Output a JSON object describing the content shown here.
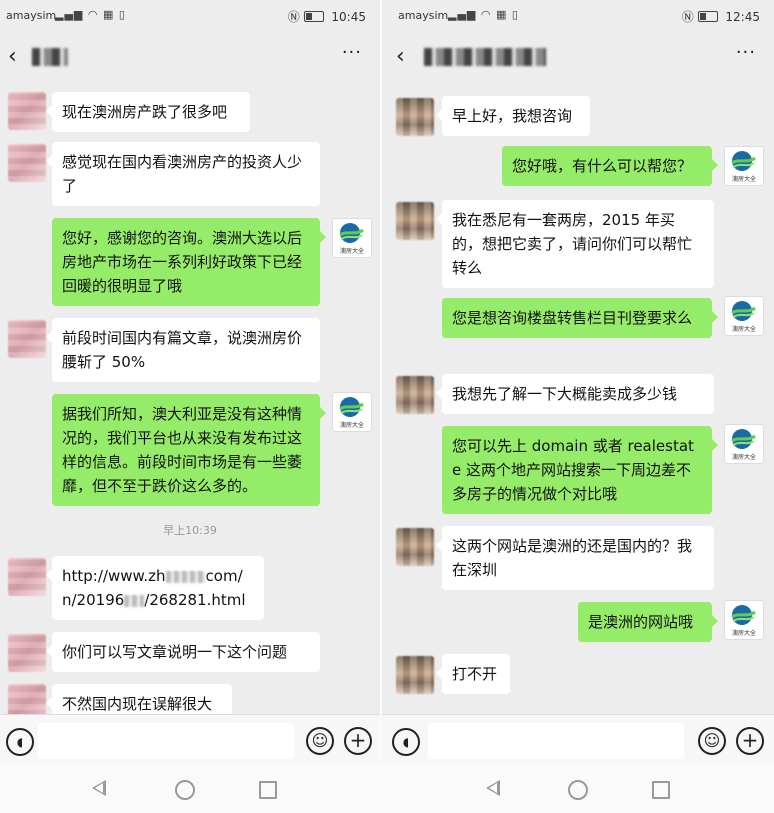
{
  "left": {
    "status": {
      "carrier": "amaysim",
      "time": "10:45"
    },
    "more_label": "···",
    "messages": [
      {
        "text": "现在澳洲房产跌了很多吧"
      },
      {
        "text": "感觉现在国内看澳洲房产的投资人少了"
      },
      {
        "text": "您好，感谢您的咨询。澳洲大选以后房地产市场在一系列利好政策下已经回暖的很明显了哦"
      },
      {
        "text": "前段时间国内有篇文章，说澳洲房价腰斩了 50%"
      },
      {
        "text": "据我们所知，澳大利亚是没有这种情况的，我们平台也从来没有发布过这样的信息。前段时间市场是有一些萎靡，但不至于跌价这么多的。"
      },
      {
        "text": "你们可以写文章说明一下这个问题"
      },
      {
        "text": "不然国内现在误解很大"
      }
    ],
    "timestamp": "早上10:39",
    "link": {
      "part1": "http://www.zh",
      "part2": "com/",
      "part3": "n/20196",
      "part4": "/268281.html"
    }
  },
  "right": {
    "status": {
      "carrier": "amaysim",
      "time": "12:45"
    },
    "more_label": "···",
    "messages": [
      {
        "text": "早上好，我想咨询"
      },
      {
        "text": "您好哦，有什么可以帮您？"
      },
      {
        "text": "我在悉尼有一套两房，2015 年买的，想把它卖了，请问你们可以帮忙转么"
      },
      {
        "text": "您是想咨询楼盘转售栏目刊登要求么"
      },
      {
        "text": "我想先了解一下大概能卖成多少钱"
      },
      {
        "text": "您可以先上 domain 或者 realestate 这两个地产网站搜索一下周边差不多房子的情况做个对比哦"
      },
      {
        "text": "这两个网站是澳洲的还是国内的？我在深圳"
      },
      {
        "text": "是澳洲的网站哦"
      },
      {
        "text": "打不开"
      }
    ]
  },
  "logo_text": "澳房大全",
  "icons": {
    "back": "‹",
    "voice": "voice-icon",
    "emoji": "emoji-icon",
    "plus": "plus-icon"
  },
  "colors": {
    "background": "#ededed",
    "outgoing_bubble": "#95ec69",
    "incoming_bubble": "#ffffff"
  }
}
